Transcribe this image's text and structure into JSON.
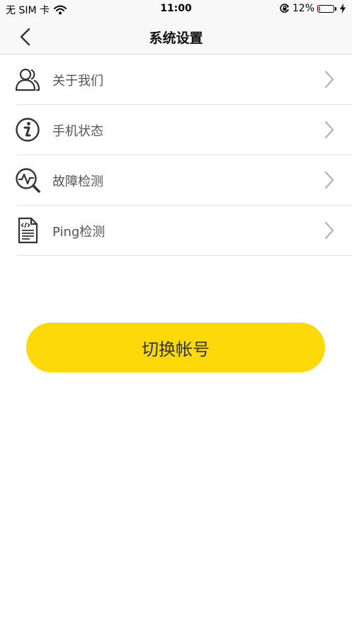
{
  "status_bar": {
    "carrier": "无 SIM 卡",
    "time": "11:00",
    "battery_percent": "12%",
    "battery_level": 0.12
  },
  "nav": {
    "title": "系统设置"
  },
  "menu": {
    "items": [
      {
        "label": "关于我们",
        "icon": "users-icon"
      },
      {
        "label": "手机状态",
        "icon": "info-icon"
      },
      {
        "label": "故障检测",
        "icon": "diagnostic-icon"
      },
      {
        "label": "Ping检测",
        "icon": "code-document-icon"
      }
    ]
  },
  "actions": {
    "switch_account_label": "切换帐号"
  },
  "colors": {
    "accent": "#fdd90a",
    "battery_low": "#e53935"
  }
}
